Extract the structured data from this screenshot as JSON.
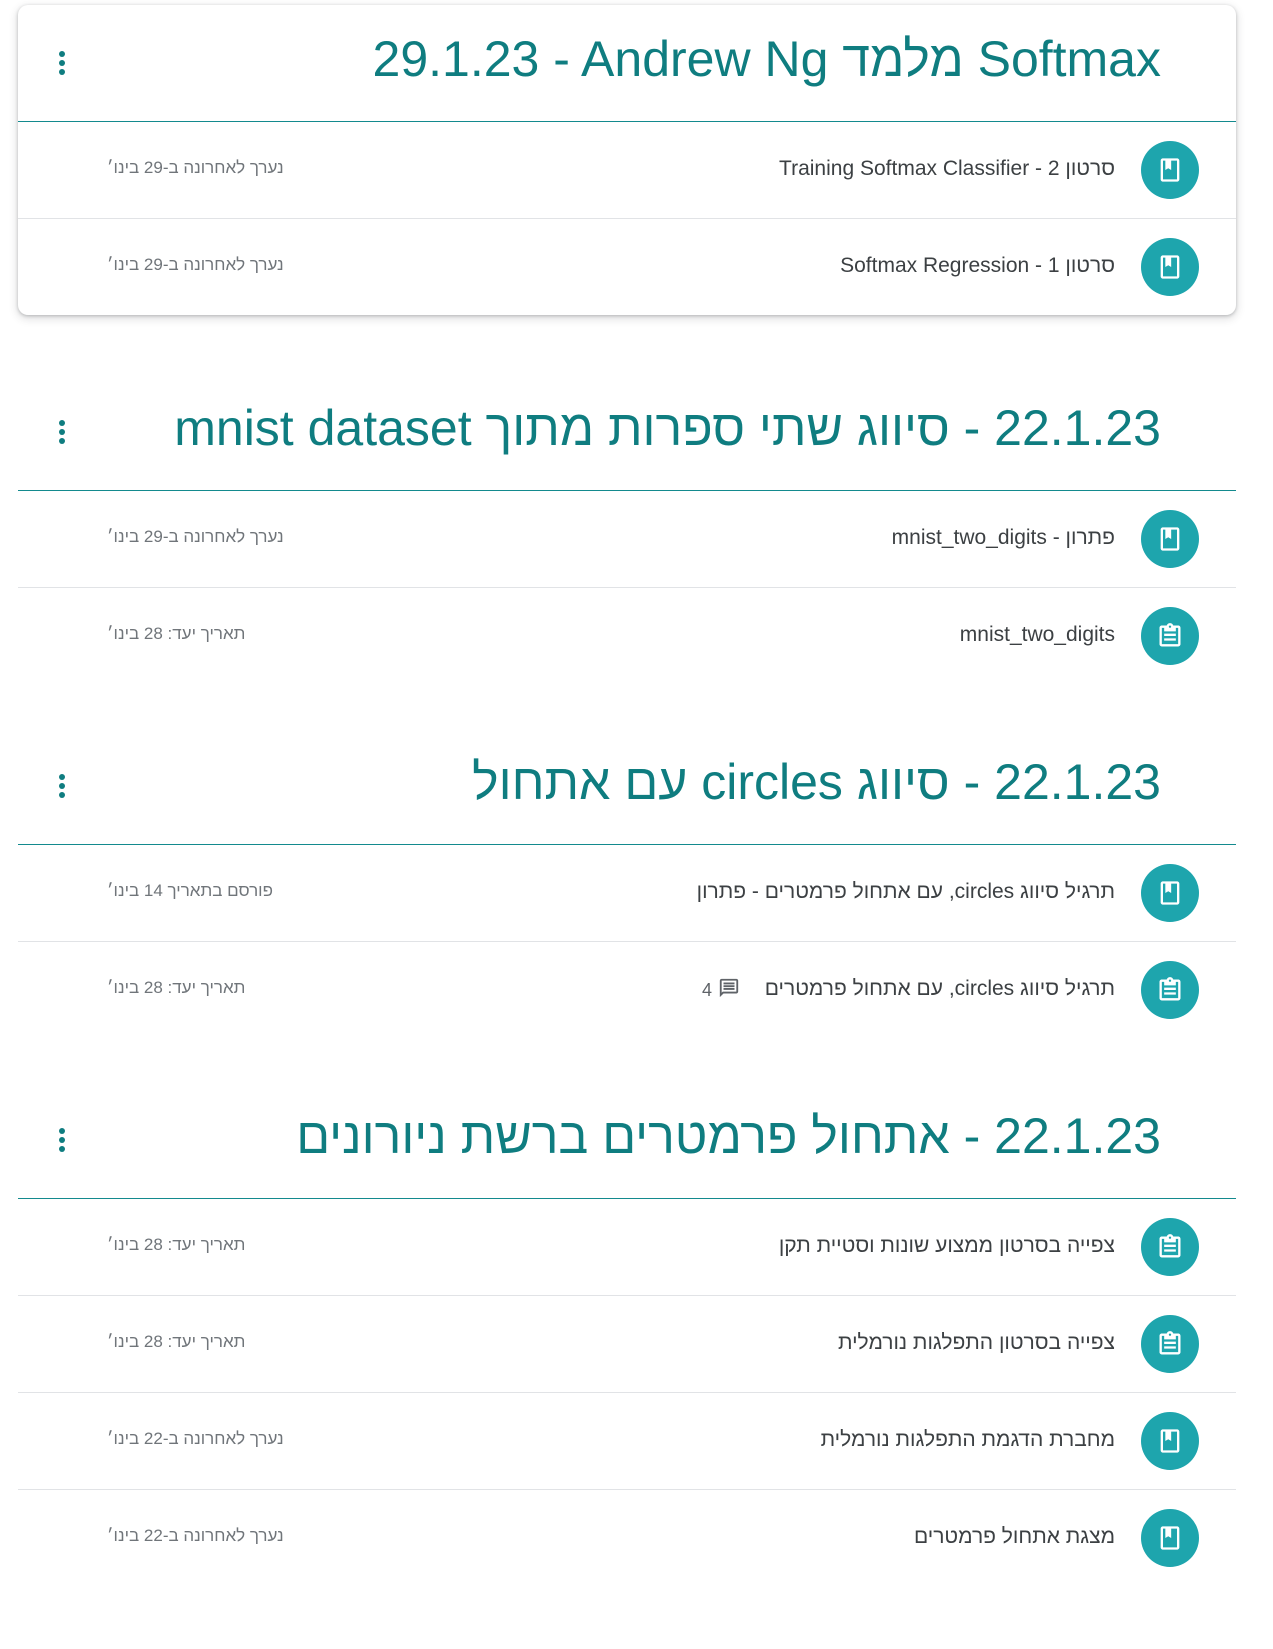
{
  "topics": [
    {
      "title": "29.1.23 - Andrew Ng מלמד Softmax",
      "items": [
        {
          "type": "material",
          "icon": "material-icon",
          "title": "סרטון 2 - Training Softmax Classifier",
          "meta": "נערך לאחרונה ב-29 בינו׳"
        },
        {
          "type": "material",
          "icon": "material-icon",
          "title": "סרטון 1 - Softmax Regression",
          "meta": "נערך לאחרונה ב-29 בינו׳"
        }
      ]
    },
    {
      "title": "22.1.23 - סיווג שתי ספרות מתוך mnist dataset",
      "items": [
        {
          "type": "material",
          "icon": "material-icon",
          "title": "mnist_two_digits - פתרון",
          "meta": "נערך לאחרונה ב-29 בינו׳"
        },
        {
          "type": "assignment",
          "icon": "assignment-icon",
          "title": "mnist_two_digits",
          "meta": "תאריך יעד: 28 בינו׳"
        }
      ]
    },
    {
      "title": "22.1.23 - סיווג circles עם אתחול",
      "items": [
        {
          "type": "material",
          "icon": "material-icon",
          "title": "תרגיל סיווג circles, עם אתחול פרמטרים - פתרון",
          "meta": "פורסם בתאריך 14 בינו׳"
        },
        {
          "type": "assignment",
          "icon": "assignment-icon",
          "title": "תרגיל סיווג circles, עם אתחול פרמטרים",
          "comments": "4",
          "meta": "תאריך יעד: 28 בינו׳"
        }
      ]
    },
    {
      "title": "22.1.23 - אתחול פרמטרים ברשת ניורונים",
      "items": [
        {
          "type": "assignment",
          "icon": "assignment-icon",
          "title": "צפייה בסרטון ממצוע שונות וסטיית תקן",
          "meta": "תאריך יעד: 28 בינו׳"
        },
        {
          "type": "assignment",
          "icon": "assignment-icon",
          "title": "צפייה בסרטון התפלגות נורמלית",
          "meta": "תאריך יעד: 28 בינו׳"
        },
        {
          "type": "material",
          "icon": "material-icon",
          "title": "מחברת הדגמת התפלגות נורמלית",
          "meta": "נערך לאחרונה ב-22 בינו׳"
        },
        {
          "type": "material",
          "icon": "material-icon",
          "title": "מצגת אתחול פרמטרים",
          "meta": "נערך לאחרונה ב-22 בינו׳"
        }
      ]
    }
  ],
  "colors": {
    "accent": "#0f7d80",
    "icon_circle": "#1ea5ad",
    "divider": "#e1e3e6"
  }
}
